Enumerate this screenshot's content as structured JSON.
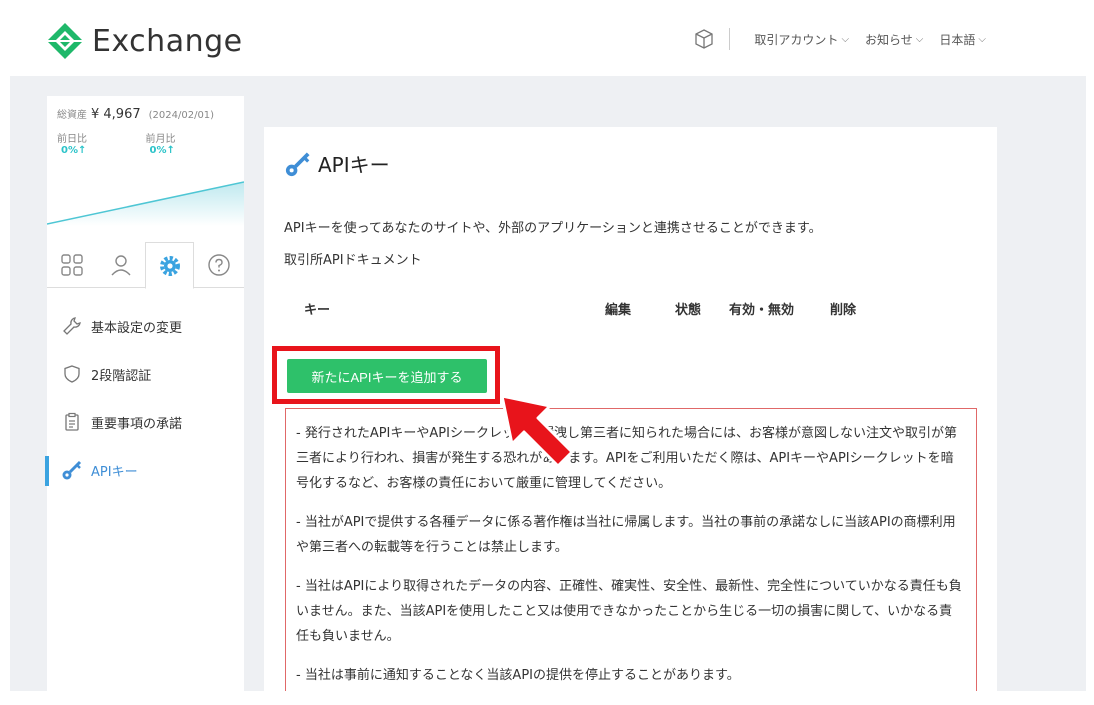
{
  "header": {
    "logo_text": "Exchange",
    "nav": [
      {
        "label": "取引アカウント"
      },
      {
        "label": "お知らせ"
      },
      {
        "label": "日本語"
      }
    ]
  },
  "sidebar": {
    "assets": {
      "label": "総資産",
      "amount": "¥ 4,967",
      "date": "(2024/02/01)",
      "day_label": "前日比",
      "day_value": "0%↑",
      "month_label": "前月比",
      "month_value": "0%↑"
    },
    "menu": [
      {
        "label": "基本設定の変更"
      },
      {
        "label": "2段階認証"
      },
      {
        "label": "重要事項の承諾"
      },
      {
        "label": "APIキー"
      }
    ]
  },
  "main": {
    "title": "APIキー",
    "description": "APIキーを使ってあなたのサイトや、外部のアプリケーションと連携させることができます。",
    "doc_link": "取引所APIドキュメント",
    "table_headers": [
      "キー",
      "編集",
      "状態",
      "有効・無効",
      "削除"
    ],
    "add_button": "新たにAPIキーを追加する",
    "notices": [
      "- 発行されたAPIキーやAPIシークレットが漏洩し第三者に知られた場合には、お客様が意図しない注文や取引が第三者により行われ、損害が発生する恐れがあります。APIをご利用いただく際は、APIキーやAPIシークレットを暗号化するなど、お客様の責任において厳重に管理してください。",
      "- 当社がAPIで提供する各種データに係る著作権は当社に帰属します。当社の事前の承諾なしに当該APIの商標利用や第三者への転載等を行うことは禁止します。",
      "- 当社はAPIにより取得されたデータの内容、正確性、確実性、安全性、最新性、完全性についていかなる責任も負いません。また、当該APIを使用したこと又は使用できなかったことから生じる一切の損害に関して、いかなる責任も負いません。",
      "- 当社は事前に通知することなく当該APIの提供を停止することがあります。"
    ]
  },
  "colors": {
    "accent_green": "#2ec16a",
    "highlight_red": "#e8141b",
    "active_blue": "#3aa3e0",
    "logo_green": "#1fb86a"
  }
}
